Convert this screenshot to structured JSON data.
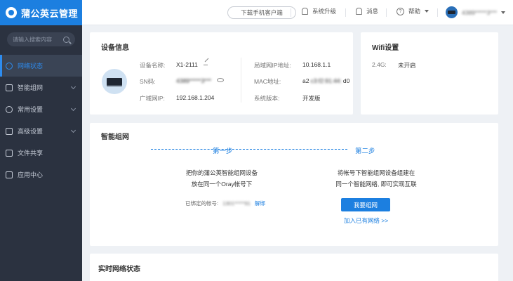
{
  "app": {
    "title": "蒲公英云管理"
  },
  "sidebar": {
    "search_placeholder": "请输入搜索内容",
    "items": [
      {
        "label": "网络状态",
        "icon": "network-icon",
        "active": true
      },
      {
        "label": "智能组网",
        "icon": "mesh-icon",
        "chevron": true
      },
      {
        "label": "常用设置",
        "icon": "settings-icon",
        "chevron": true
      },
      {
        "label": "高级设置",
        "icon": "advanced-icon",
        "chevron": true
      },
      {
        "label": "文件共享",
        "icon": "folder-icon"
      },
      {
        "label": "应用中心",
        "icon": "apps-icon"
      }
    ]
  },
  "topbar": {
    "download_client": "下载手机客户端",
    "upgrade": "系统升级",
    "messages": "消息",
    "help": "帮助",
    "account": "4389*****3***"
  },
  "device_info": {
    "title": "设备信息",
    "name_label": "设备名称:",
    "name_value": "X1-2111",
    "sn_label": "SN码:",
    "sn_value": "4389*****3***",
    "wan_ip_label": "广域网IP:",
    "wan_ip_value": "192.168.1.204",
    "lan_ip_label": "局域网IP地址:",
    "lan_ip_value": "10.168.1.1",
    "mac_label": "MAC地址:",
    "mac_value_start": "a2",
    "mac_value_masked": "c3:f2:91:44:",
    "mac_value_end": "d0",
    "version_label": "系统版本:",
    "version_value": "开发版"
  },
  "wifi": {
    "title": "Wifi设置",
    "band_label": "2.4G:",
    "band_value": "未开启"
  },
  "mesh": {
    "title": "智能组网",
    "step1": "第一步",
    "step2": "第二步",
    "step1_line1": "把你的蒲公英智能组网设备",
    "step1_line2": "放在同一个Oray帐号下",
    "bound_label": "已绑定的帐号:",
    "bound_value": "1301*****91",
    "unbind": "解绑",
    "step2_line1": "将帐号下智能组网设备组建在",
    "step2_line2": "同一个智能网络, 即可实现互联",
    "create_button": "我要组网",
    "join_link": "加入已有网络 >>"
  },
  "realtime": {
    "title": "实时网络状态"
  },
  "colors": {
    "accent": "#1c7fe0",
    "sidebar_bg": "#2b3240"
  }
}
